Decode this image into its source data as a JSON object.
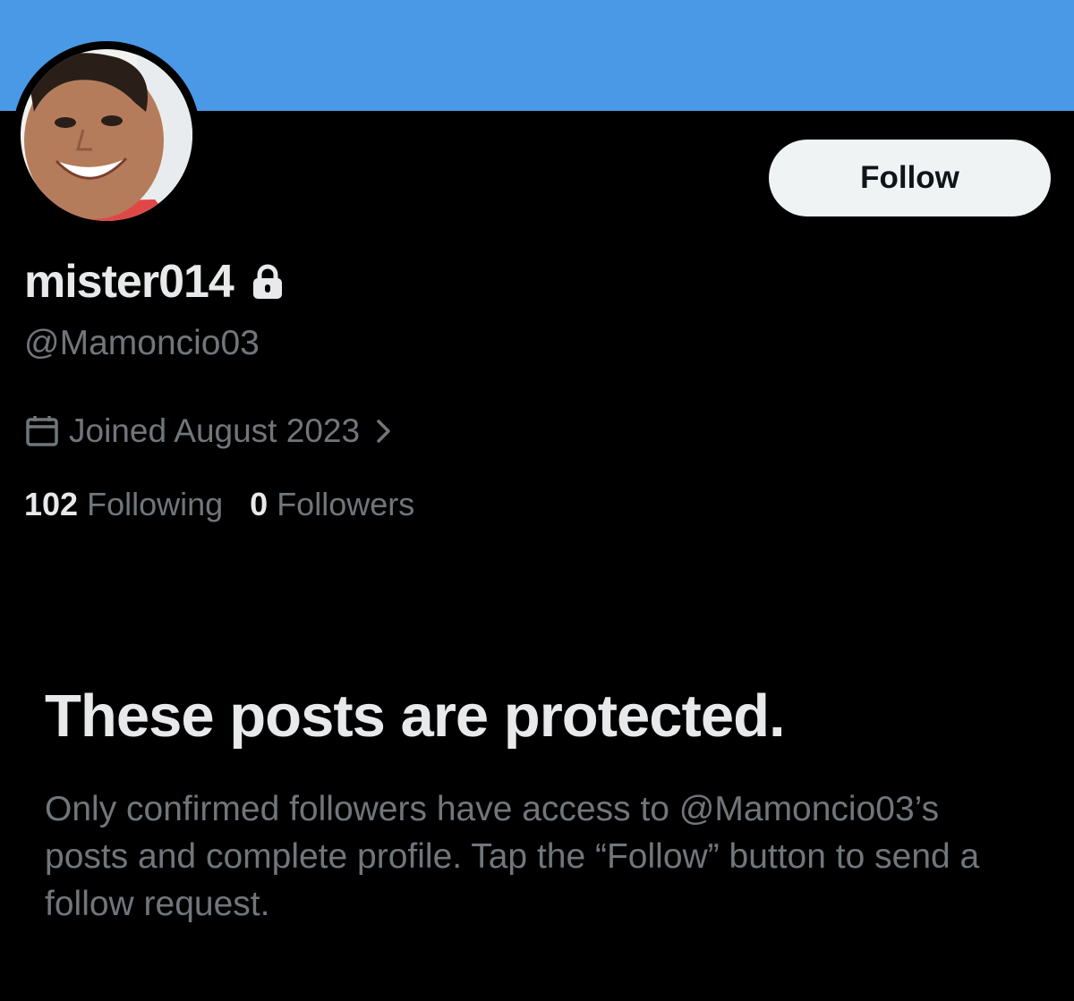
{
  "profile": {
    "display_name": "mister014",
    "handle": "@Mamoncio03",
    "joined": "Joined August 2023",
    "following_count": "102",
    "following_label": "Following",
    "followers_count": "0",
    "followers_label": "Followers"
  },
  "actions": {
    "follow_label": "Follow"
  },
  "protected": {
    "title": "These posts are protected.",
    "description": "Only confirmed followers have access to @Mamoncio03’s posts and complete profile. Tap the “Follow” button to send a follow request."
  },
  "icons": {
    "lock": "lock-icon",
    "calendar": "calendar-icon",
    "chevron": "chevron-right-icon"
  },
  "colors": {
    "banner": "#4a99e6",
    "background": "#000000",
    "primary_text": "#e7e9ea",
    "secondary_text": "#71767b",
    "follow_button_bg": "#eff3f4"
  }
}
